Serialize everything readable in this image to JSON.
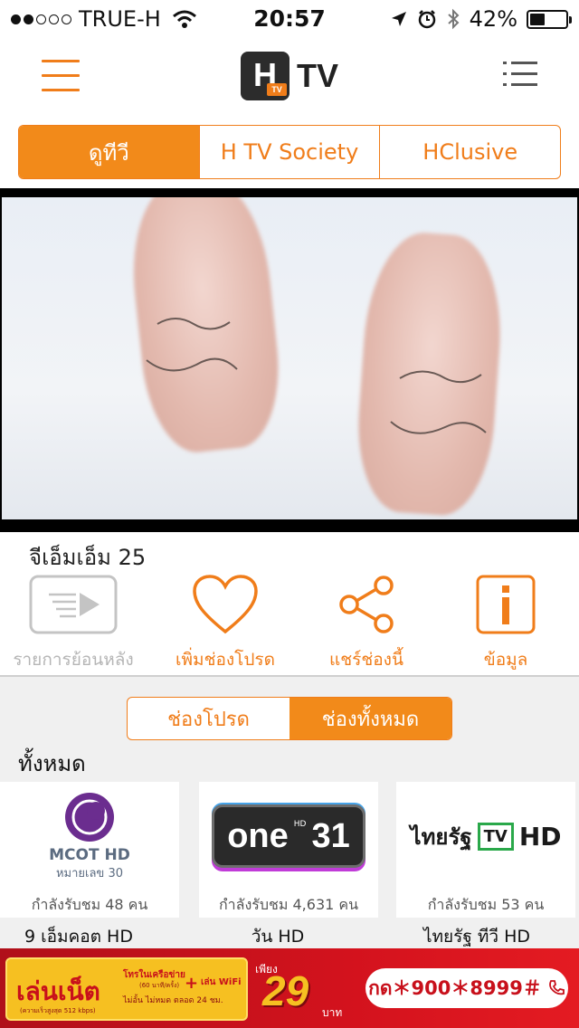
{
  "status_bar": {
    "carrier": "TRUE-H",
    "time": "20:57",
    "battery": "42%",
    "battery_level": 0.42,
    "signal_bars_filled": 2,
    "signal_bars_total": 5
  },
  "header": {
    "logo_letter": "H",
    "logo_badge": "TV",
    "logo_text": "TV"
  },
  "top_tabs": [
    {
      "label": "ดูทีวี",
      "active": true
    },
    {
      "label": "H TV Society",
      "active": false
    },
    {
      "label": "HClusive",
      "active": false
    }
  ],
  "channel": {
    "title": "จีเอ็มเอ็ม 25"
  },
  "actions": [
    {
      "label": "รายการย้อนหลัง",
      "icon": "playback-icon"
    },
    {
      "label": "เพิ่มช่องโปรด",
      "icon": "heart-icon"
    },
    {
      "label": "แชร์ช่องนี้",
      "icon": "share-icon"
    },
    {
      "label": "ข้อมูล",
      "icon": "info-icon"
    }
  ],
  "channel_tabs": [
    {
      "label": "ช่องโปรด",
      "active": false
    },
    {
      "label": "ช่องทั้งหมด",
      "active": true
    }
  ],
  "section_label": "ทั้งหมด",
  "channels": [
    {
      "logo_line1": "MCOT HD",
      "logo_line2": "หมายเลข 30",
      "viewers": "กำลังรับชม 48 คน",
      "name": "9 เอ็มคอต HD"
    },
    {
      "logo_line1": "one",
      "logo_line2": "31",
      "logo_hd": "HD",
      "viewers": "กำลังรับชม 4,631 คน",
      "name": "วัน HD"
    },
    {
      "logo_line1": "ไทยรัฐ",
      "logo_line2": "TV",
      "logo_hd": "HD",
      "viewers": "กำลังรับชม 53 คน",
      "name": "ไทยรัฐ ทีวี HD"
    }
  ],
  "banner": {
    "title": "เล่นเน็ต",
    "line1": "โทรในเครือข่าย",
    "line1_sub": "(60 นาที/ครั้ง)",
    "plus": "+",
    "wifi": "เล่น WiFi",
    "line2": "ไม่อั้น ไม่หมด ตลอด 24 ชม.",
    "speed": "(ความเร็วสูงสุด 512 kbps)",
    "price_prefix": "เพียง",
    "price": "29",
    "currency": "บาท",
    "code": "กด＊900＊8999＃"
  },
  "colors": {
    "accent": "#f07d1a",
    "tab_active": "#f28a1a",
    "banner_red": "#d3121d",
    "banner_gold": "#f6c021"
  }
}
